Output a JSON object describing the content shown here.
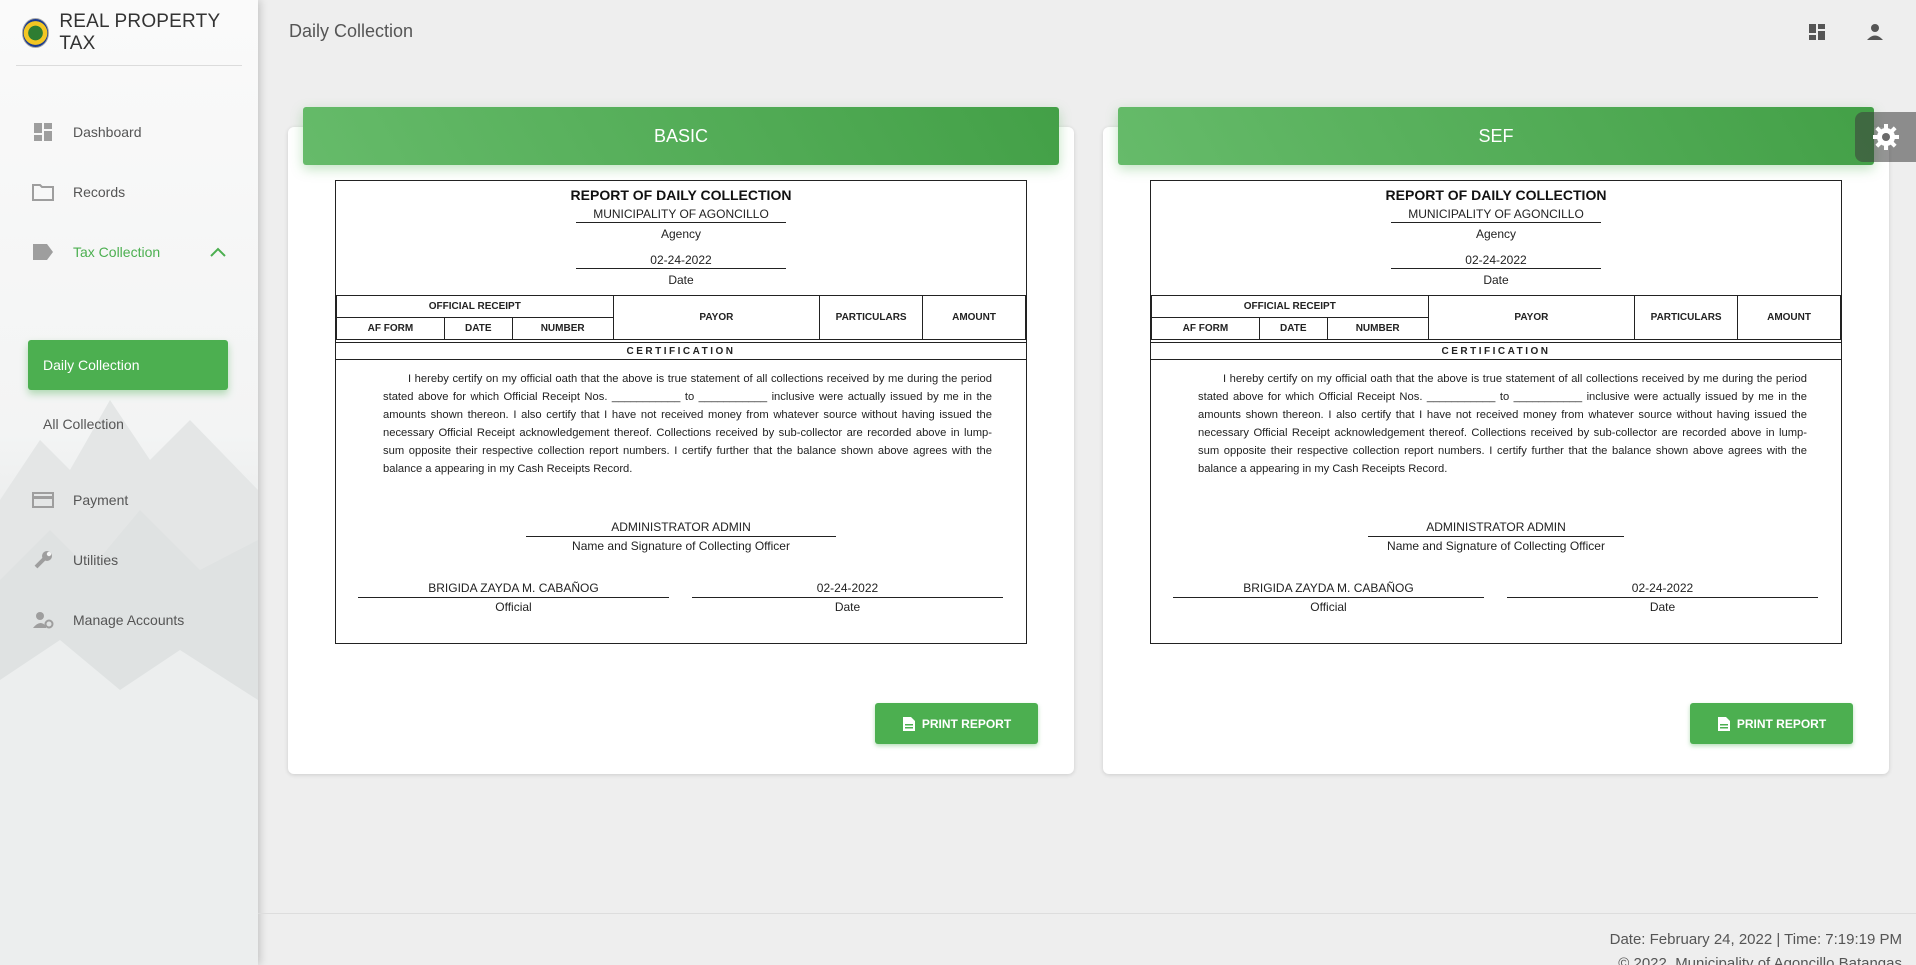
{
  "app": {
    "title": "REAL PROPERTY TAX",
    "page_title": "Daily Collection"
  },
  "sidebar": {
    "items": [
      {
        "label": "Dashboard",
        "icon": "dashboard-icon"
      },
      {
        "label": "Records",
        "icon": "folder-icon"
      },
      {
        "label": "Tax Collection",
        "icon": "label-icon",
        "expanded": true
      },
      {
        "label": "Payment",
        "icon": "credit-card-icon"
      },
      {
        "label": "Utilities",
        "icon": "wrench-icon"
      },
      {
        "label": "Manage Accounts",
        "icon": "manage-accounts-icon"
      }
    ],
    "subitems": [
      {
        "label": "Daily Collection",
        "active": true
      },
      {
        "label": "All Collection",
        "active": false
      }
    ]
  },
  "cards": [
    {
      "header": "BASIC",
      "report": {
        "title": "REPORT OF DAILY COLLECTION",
        "municipality": "MUNICIPALITY OF AGONCILLO",
        "agency_label": "Agency",
        "date_value": "02-24-2022",
        "date_label": "Date",
        "col_official_receipt": "OFFICIAL RECEIPT",
        "col_af_form": "AF FORM",
        "col_date": "DATE",
        "col_number": "NUMBER",
        "col_payor": "PAYOR",
        "col_particulars": "PARTICULARS",
        "col_amount": "AMOUNT",
        "certification_head": "CERTIFICATION",
        "certification_text": "I hereby certify on my official oath that the above is true statement of all collections received by me during the period stated above for which Official Receipt Nos. ___________ to ___________ inclusive were actually issued by me in the amounts shown thereon. I also certify that I have not received money from whatever source without having issued the necessary Official Receipt acknowledgement thereof. Collections received by sub-collector are recorded above in lump-sum opposite their respective collection report numbers. I certify further that the balance shown above agrees with the balance a appearing in my Cash Receipts Record.",
        "collecting_officer": "ADMINISTRATOR ADMIN",
        "collecting_officer_caption": "Name and Signature of Collecting Officer",
        "official_name": "BRIGIDA ZAYDA M. CABAÑOG",
        "official_caption": "Official",
        "sign_date": "02-24-2022",
        "sign_date_caption": "Date"
      },
      "print_label": "PRINT REPORT"
    },
    {
      "header": "SEF",
      "report": {
        "title": "REPORT OF DAILY COLLECTION",
        "municipality": "MUNICIPALITY OF AGONCILLO",
        "agency_label": "Agency",
        "date_value": "02-24-2022",
        "date_label": "Date",
        "col_official_receipt": "OFFICIAL RECEIPT",
        "col_af_form": "AF FORM",
        "col_date": "DATE",
        "col_number": "NUMBER",
        "col_payor": "PAYOR",
        "col_particulars": "PARTICULARS",
        "col_amount": "AMOUNT",
        "certification_head": "CERTIFICATION",
        "certification_text": "I hereby certify on my official oath that the above is true statement of all collections received by me during the period stated above for which Official Receipt Nos. ___________ to ___________ inclusive were actually issued by me in the amounts shown thereon. I also certify that I have not received money from whatever source without having issued the necessary Official Receipt acknowledgement thereof. Collections received by sub-collector are recorded above in lump-sum opposite their respective collection report numbers. I certify further that the balance shown above agrees with the balance a appearing in my Cash Receipts Record.",
        "collecting_officer": "ADMINISTRATOR ADMIN",
        "collecting_officer_caption": "Name and Signature of Collecting Officer",
        "official_name": "BRIGIDA ZAYDA M. CABAÑOG",
        "official_caption": "Official",
        "sign_date": "02-24-2022",
        "sign_date_caption": "Date"
      },
      "print_label": "PRINT REPORT"
    }
  ],
  "footer": {
    "datetime": "Date: February 24, 2022 | Time: 7:19:19 PM",
    "copyright": "© 2022, Municipality of Agoncillo Batangas"
  },
  "colors": {
    "accent": "#4caf50",
    "accent_dark": "#43a047"
  }
}
